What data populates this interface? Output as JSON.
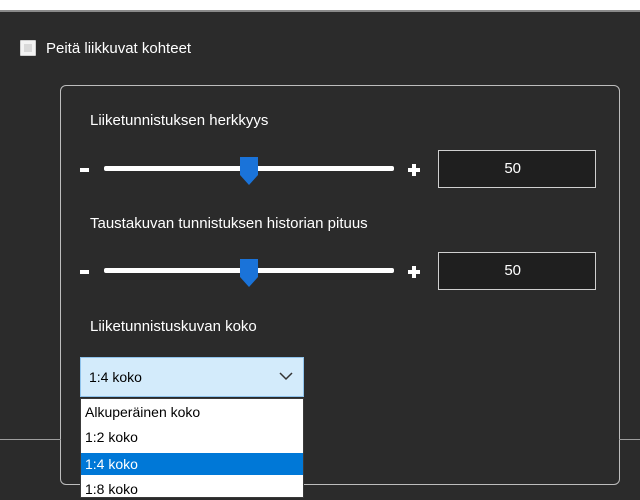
{
  "hide_moving_objects": {
    "label": "Peitä liikkuvat kohteet",
    "checked": false
  },
  "sensitivity": {
    "label": "Liiketunnistuksen herkkyys",
    "minus": "-",
    "plus": "+",
    "value": "50",
    "level_fraction": 0.5
  },
  "history": {
    "label": "Taustakuvan tunnistuksen historian pituus",
    "minus": "-",
    "plus": "+",
    "value": "50",
    "level_fraction": 0.5
  },
  "image_size": {
    "label": "Liiketunnistuskuvan koko",
    "selected": "1:4 koko",
    "options": [
      "Alkuperäinen koko",
      "1:2 koko",
      "1:4 koko",
      "1:8 koko"
    ],
    "selected_index": 2
  },
  "colors": {
    "background": "#2b2b2b",
    "accent": "#0078d7",
    "thumb": "#1a73d9",
    "combo_bg": "#d3ebfb"
  }
}
